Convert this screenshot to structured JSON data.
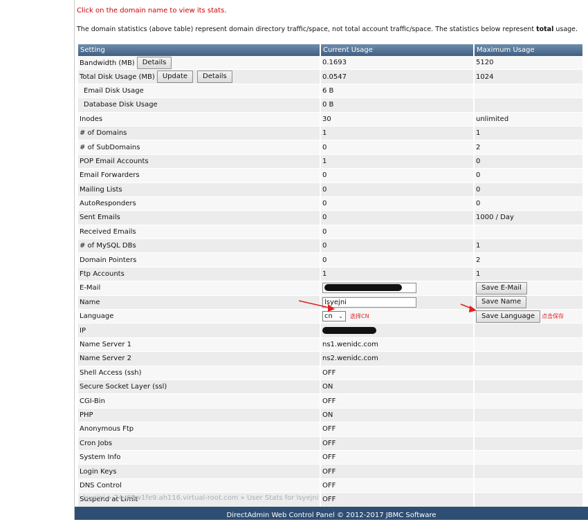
{
  "notice": "Click on the domain name to view its stats.",
  "description": {
    "before": "The domain statistics (above table) represent domain directory traffic/space, not total account traffic/space. The statistics below represent ",
    "bold": "total",
    "after": " usage."
  },
  "table": {
    "headers": [
      "Setting",
      "Current Usage",
      "Maximum Usage"
    ],
    "rows": [
      {
        "setting": "Bandwidth (MB)",
        "current": "0.1693",
        "max": "5120"
      },
      {
        "setting": "Total Disk Usage (MB)",
        "current": "0.0547",
        "max": "1024"
      },
      {
        "setting": "Email Disk Usage",
        "current": "6 B",
        "max": ""
      },
      {
        "setting": "Database Disk Usage",
        "current": "0 B",
        "max": ""
      },
      {
        "setting": "Inodes",
        "current": "30",
        "max": "unlimited"
      },
      {
        "setting": "# of Domains",
        "current": "1",
        "max": "1"
      },
      {
        "setting": "# of SubDomains",
        "current": "0",
        "max": "2"
      },
      {
        "setting": "POP Email Accounts",
        "current": "1",
        "max": "0"
      },
      {
        "setting": "Email Forwarders",
        "current": "0",
        "max": "0"
      },
      {
        "setting": "Mailing Lists",
        "current": "0",
        "max": "0"
      },
      {
        "setting": "AutoResponders",
        "current": "0",
        "max": "0"
      },
      {
        "setting": "Sent Emails",
        "current": "0",
        "max": "1000 / Day"
      },
      {
        "setting": "Received Emails",
        "current": "0",
        "max": ""
      },
      {
        "setting": "# of MySQL DBs",
        "current": "0",
        "max": "1"
      },
      {
        "setting": "Domain Pointers",
        "current": "0",
        "max": "2"
      },
      {
        "setting": "Ftp Accounts",
        "current": "1",
        "max": "1"
      },
      {
        "setting": "E-Mail",
        "current": "",
        "max": ""
      },
      {
        "setting": "Name",
        "current": "lsyejni",
        "max": ""
      },
      {
        "setting": "Language",
        "current": "cn",
        "max": ""
      },
      {
        "setting": "IP",
        "current": "",
        "max": ""
      },
      {
        "setting": "Name Server 1",
        "current": "ns1.wenidc.com",
        "max": ""
      },
      {
        "setting": "Name Server 2",
        "current": "ns2.wenidc.com",
        "max": ""
      },
      {
        "setting": "Shell Access (ssh)",
        "current": "OFF",
        "max": ""
      },
      {
        "setting": "Secure Socket Layer (ssl)",
        "current": "ON",
        "max": ""
      },
      {
        "setting": "CGI-Bin",
        "current": "OFF",
        "max": ""
      },
      {
        "setting": "PHP",
        "current": "ON",
        "max": ""
      },
      {
        "setting": "Anonymous Ftp",
        "current": "OFF",
        "max": ""
      },
      {
        "setting": "Cron Jobs",
        "current": "OFF",
        "max": ""
      },
      {
        "setting": "System Info",
        "current": "OFF",
        "max": ""
      },
      {
        "setting": "Login Keys",
        "current": "OFF",
        "max": ""
      },
      {
        "setting": "DNS Control",
        "current": "OFF",
        "max": ""
      },
      {
        "setting": "Suspend at Limit",
        "current": "OFF",
        "max": ""
      }
    ]
  },
  "buttons": {
    "details": "Details",
    "update": "Update",
    "save_email": "Save E-Mail",
    "save_name": "Save Name",
    "save_language": "Save Language"
  },
  "annotations": {
    "select_cn": "选择CN",
    "click_save": "点击保存"
  },
  "breadcrumb": {
    "user": "lsyejni",
    "sep": " » ",
    "host": "74v85w1fe9.ah116.virtual-root.com",
    "page": "User Stats for lsyejni"
  },
  "footer": "DirectAdmin Web Control Panel © 2012-2017 JBMC Software",
  "colors": {
    "header_bg": "#4a6a8e",
    "notice": "#cc0000",
    "annotation": "#e02020",
    "footer_bg": "#2f4e73"
  }
}
